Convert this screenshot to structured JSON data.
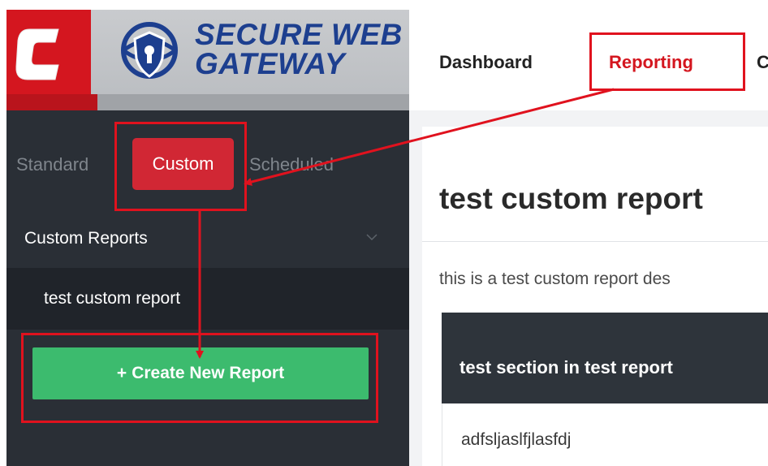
{
  "brand": {
    "line1": "SECURE WEB",
    "line2": "GATEWAY",
    "primary_color": "#d4161f",
    "text_color": "#1d3f8f"
  },
  "topnav": {
    "items": [
      {
        "label": "Dashboard"
      },
      {
        "label": "Reporting",
        "active": true
      },
      {
        "label": "C"
      }
    ]
  },
  "sidebar": {
    "tabs": [
      {
        "label": "Standard"
      },
      {
        "label": "Custom",
        "active": true
      },
      {
        "label": "Scheduled"
      }
    ],
    "section_label": "Custom Reports",
    "reports": [
      {
        "label": "test custom report"
      }
    ],
    "create_button": {
      "icon": "+",
      "label": "Create New Report",
      "color": "#3cbb6e"
    }
  },
  "main": {
    "title": "test custom report",
    "description": "this is a test custom report des",
    "section": {
      "title": "test section in test report",
      "content": "adfsljaslfjlasfdj"
    }
  },
  "annotations": {
    "highlight_color": "#e0121e",
    "items": [
      "Reporting tab",
      "Custom tab",
      "Create New Report button"
    ]
  }
}
